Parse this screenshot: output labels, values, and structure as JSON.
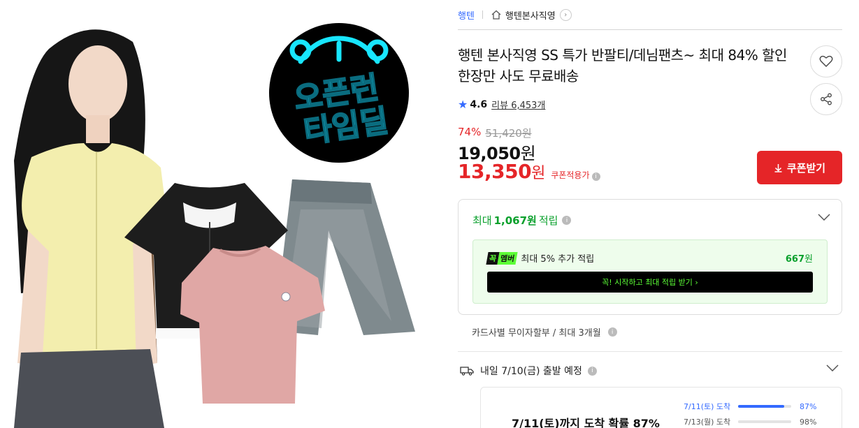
{
  "breadcrumb": {
    "brand": "행텐",
    "shop": "행텐본사직영"
  },
  "image": {
    "badge_line1": "오픈런",
    "badge_line2": "타임딜",
    "badge_color": "#18e6ff"
  },
  "product": {
    "title": "행텐 본사직영 SS 특가 반팔티/데님팬츠~ 최대 84% 할인 한장만 사도 무료배송",
    "rating": "4.6",
    "review_label": "리뷰 6,453개"
  },
  "price": {
    "discount_rate": "74%",
    "original": "51,420원",
    "sale_amount": "19,050",
    "sale_unit": "원",
    "coupon_amount": "13,350",
    "coupon_unit": "원",
    "coupon_note": "쿠폰적용가"
  },
  "coupon_button": {
    "label": "쿠폰받기"
  },
  "reward": {
    "prefix": "최대",
    "amount": "1,067원",
    "suffix": "적립",
    "member_kkok": "꼭",
    "member_mem": "멤버",
    "member_extra": "최대 5% 추가 적립",
    "member_points": "667",
    "member_points_unit": "원",
    "member_cta": "꼭! 시작하고 최대 적립 받기  ›"
  },
  "installment": {
    "text": "카드사별 무이자할부 / 최대 3개월"
  },
  "delivery": {
    "text": "내일 7/10(금) 출발 예정",
    "probability_title": "7/11(토)까지 도착 확률 87%",
    "rows": [
      {
        "date": "7/11(토) 도착",
        "pct": "87%",
        "value": 0.87
      },
      {
        "date": "7/13(월) 도착",
        "pct": "98%",
        "value": 0.98
      }
    ]
  },
  "colors": {
    "accent_red": "#e52528",
    "accent_blue": "#346aff",
    "green": "#0aa02c",
    "neon_green": "#5cff36"
  }
}
